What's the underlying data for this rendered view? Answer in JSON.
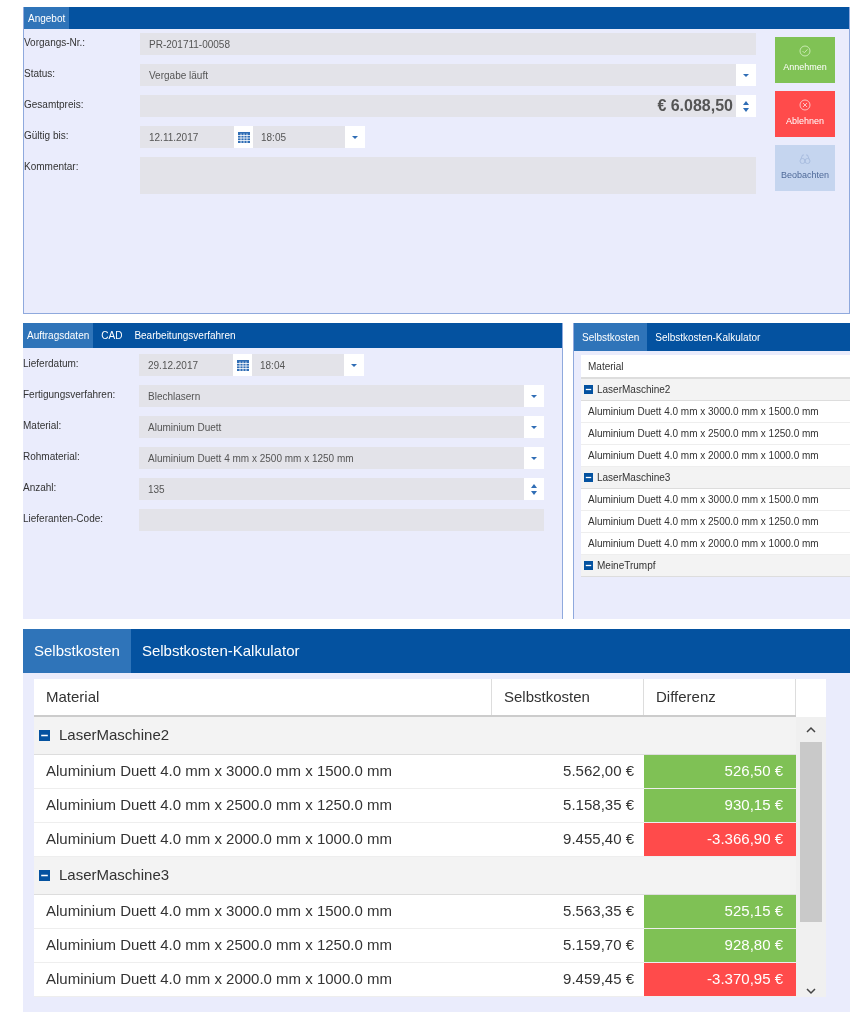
{
  "offer": {
    "tabs": [
      {
        "label": "Angebot",
        "selected": true
      }
    ],
    "fields": [
      {
        "kind": "text",
        "label": "Vorgangs-Nr.:",
        "value": "PR-201711-00058"
      },
      {
        "kind": "select",
        "label": "Status:",
        "value": "Vergabe läuft"
      },
      {
        "kind": "number",
        "label": "Gesamtpreis:",
        "value": "€ 6.088,50"
      },
      {
        "kind": "datetime",
        "label": "Gültig bis:",
        "date": "12.11.2017",
        "time": "18:05"
      },
      {
        "kind": "textarea",
        "label": "Kommentar:"
      }
    ],
    "buttons": [
      {
        "kind": "accept",
        "label": "Annehmen",
        "disabled": false
      },
      {
        "kind": "reject",
        "label": "Ablehnen",
        "disabled": false
      },
      {
        "kind": "watch",
        "label": "Beobachten",
        "disabled": true
      }
    ]
  },
  "order": {
    "tabs": [
      {
        "label": "Auftragsdaten",
        "selected": true
      },
      {
        "label": "CAD",
        "selected": false
      },
      {
        "label": "Bearbeitungsverfahren",
        "selected": false
      }
    ],
    "fields": [
      {
        "kind": "datetime",
        "label": "Lieferdatum:",
        "date": "29.12.2017",
        "time": "18:04"
      },
      {
        "kind": "select",
        "label": "Fertigungsverfahren:",
        "value": "Blechlasern"
      },
      {
        "kind": "select",
        "label": "Material:",
        "value": "Aluminium Duett"
      },
      {
        "kind": "select",
        "label": "Rohmaterial:",
        "value": "Aluminium Duett 4 mm x 2500 mm x 1250 mm"
      },
      {
        "kind": "number",
        "label": "Anzahl:",
        "value": "135"
      },
      {
        "kind": "text",
        "label": "Lieferanten-Code:"
      }
    ]
  },
  "costs_preview": {
    "tabs": [
      {
        "label": "Selbstkosten",
        "selected": true
      },
      {
        "label": "Selbstkosten-Kalkulator",
        "selected": false
      }
    ],
    "column": "Material",
    "groups": [
      {
        "name": "LaserMaschine2",
        "expanded": true,
        "rows": [
          "Aluminium Duett 4.0 mm x 3000.0 mm x 1500.0 mm",
          "Aluminium Duett 4.0 mm x 2500.0 mm x 1250.0 mm",
          "Aluminium Duett 4.0 mm x 2000.0 mm x 1000.0 mm"
        ]
      },
      {
        "name": "LaserMaschine3",
        "expanded": true,
        "rows": [
          "Aluminium Duett 4.0 mm x 3000.0 mm x 1500.0 mm",
          "Aluminium Duett 4.0 mm x 2500.0 mm x 1250.0 mm",
          "Aluminium Duett 4.0 mm x 2000.0 mm x 1000.0 mm"
        ]
      },
      {
        "name": "MeineTrumpf",
        "expanded": true
      }
    ]
  },
  "costs": {
    "tabs": [
      {
        "label": "Selbstkosten",
        "selected": true
      },
      {
        "label": "Selbstkosten-Kalkulator",
        "selected": false
      }
    ],
    "columns": [
      "Material",
      "Selbstkosten",
      "Differenz"
    ],
    "groups": [
      {
        "name": "LaserMaschine2",
        "expanded": true,
        "rows": [
          {
            "material": "Aluminium Duett 4.0 mm x 3000.0 mm x 1500.0 mm",
            "cost": "5.562,00 €",
            "difference": "526,50 €",
            "color": "#7fc155"
          },
          {
            "material": "Aluminium Duett 4.0 mm x 2500.0 mm x 1250.0 mm",
            "cost": "5.158,35 €",
            "difference": "930,15 €",
            "color": "#7fc155"
          },
          {
            "material": "Aluminium Duett 4.0 mm x 2000.0 mm x 1000.0 mm",
            "cost": "9.455,40 €",
            "difference": "-3.366,90 €",
            "color": "#ff4b4b"
          }
        ]
      },
      {
        "name": "LaserMaschine3",
        "expanded": true,
        "rows": [
          {
            "material": "Aluminium Duett 4.0 mm x 3000.0 mm x 1500.0 mm",
            "cost": "5.563,35 €",
            "difference": "525,15 €",
            "color": "#7fc155"
          },
          {
            "material": "Aluminium Duett 4.0 mm x 2500.0 mm x 1250.0 mm",
            "cost": "5.159,70 €",
            "difference": "928,80 €",
            "color": "#7fc155"
          },
          {
            "material": "Aluminium Duett 4.0 mm x 2000.0 mm x 1000.0 mm",
            "cost": "9.459,45 €",
            "difference": "-3.370,95 €",
            "color": "#ff4b4b"
          }
        ]
      }
    ]
  }
}
